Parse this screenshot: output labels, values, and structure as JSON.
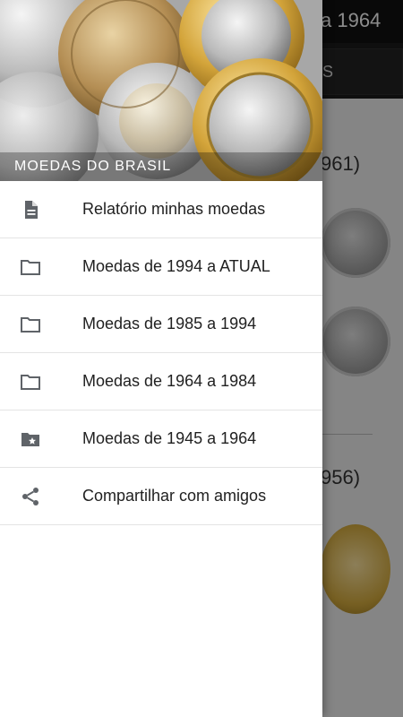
{
  "background_app": {
    "toolbar_title": "a 1964",
    "tab_label": "S",
    "section_1_year": "961)",
    "section_2_year": "956)"
  },
  "drawer": {
    "header_title": "MOEDAS DO BRASIL",
    "items": [
      {
        "label": "Relatório minhas moedas",
        "icon": "document-icon"
      },
      {
        "label": "Moedas de 1994 a ATUAL",
        "icon": "folder-icon"
      },
      {
        "label": "Moedas de 1985 a 1994",
        "icon": "folder-icon"
      },
      {
        "label": "Moedas de 1964 a 1984",
        "icon": "folder-icon"
      },
      {
        "label": "Moedas de 1945 a 1964",
        "icon": "folder-star-icon"
      },
      {
        "label": "Compartilhar com amigos",
        "icon": "share-icon"
      }
    ]
  },
  "colors": {
    "toolbar": "#111111",
    "drawer_bg": "#ffffff",
    "icon": "#5f6368",
    "text": "#212121"
  }
}
